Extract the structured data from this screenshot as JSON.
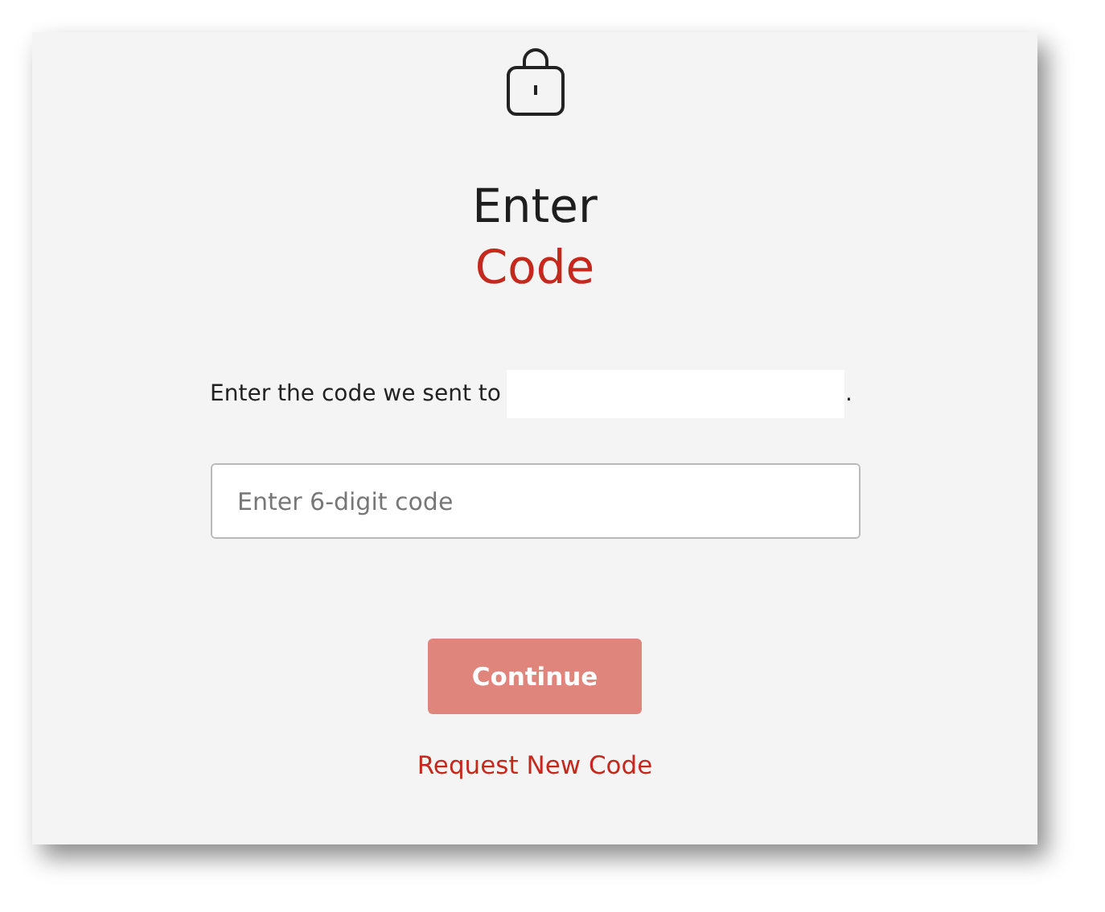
{
  "title": {
    "line_1": "Enter",
    "line_2": "Code"
  },
  "prompt": {
    "text": "Enter the code we sent to",
    "end": "."
  },
  "code_field": {
    "placeholder": "Enter 6-digit code"
  },
  "continue_button": {
    "label": "Continue",
    "disabled": true
  },
  "request_link": {
    "label": "Request New Code"
  }
}
